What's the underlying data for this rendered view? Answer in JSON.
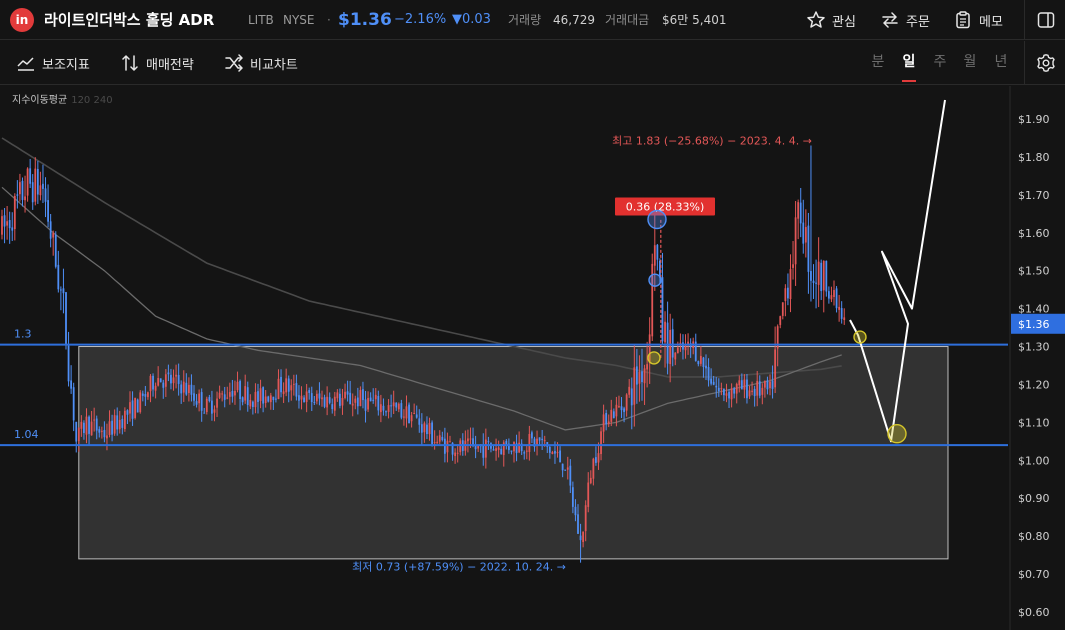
{
  "header": {
    "logo_text": "in",
    "title": "라이트인더박스 홀딩 ADR",
    "ticker": "LITB",
    "exchange": "NYSE",
    "separator": "·",
    "price": "$1.36",
    "change_pct": "−2.16%",
    "change_abs": "▼0.03",
    "volume_label": "거래량",
    "volume_value": "46,729",
    "amount_label": "거래대금",
    "amount_value": "$6만 5,401",
    "buttons": {
      "watch": "관심",
      "order": "주문",
      "memo": "메모"
    }
  },
  "toolbar": {
    "indicators": "보조지표",
    "strategy": "매매전략",
    "compare": "비교차트",
    "periods": [
      "분",
      "일",
      "주",
      "월",
      "년"
    ],
    "active_period": "일",
    "ma_label": "지수이동평균",
    "ma_periods": "120  240"
  },
  "icons": {
    "watch": "star-icon",
    "order": "swap-arrows-icon",
    "memo": "clipboard-icon",
    "panel": "side-panel-icon",
    "settings": "gear-icon",
    "indicators": "line-chart-icon",
    "strategy": "updown-arrows-icon",
    "compare": "shuffle-icon"
  },
  "colors": {
    "accent_blue": "#4f8ff7",
    "up": "#e35757",
    "down": "#4f8ff7",
    "brand_red": "#e23b3b",
    "level_line": "#2e6fdc",
    "highlight": "#d4c52a"
  },
  "chart_data": {
    "type": "candlestick",
    "yaxis_ticks": [
      "$1.90",
      "$1.80",
      "$1.70",
      "$1.60",
      "$1.50",
      "$1.40",
      "$1.30",
      "$1.20",
      "$1.10",
      "$1.00",
      "$0.90",
      "$0.80",
      "$0.70",
      "$0.60"
    ],
    "y_tick_values": [
      1.9,
      1.8,
      1.7,
      1.6,
      1.5,
      1.4,
      1.3,
      1.2,
      1.1,
      1.0,
      0.9,
      0.8,
      0.7,
      0.6
    ],
    "ylim": [
      0.6,
      1.9
    ],
    "current_price_tag": "$1.36",
    "current_price": 1.36,
    "levels": [
      {
        "label": "1.3",
        "value": 1.305
      },
      {
        "label": "1.04",
        "value": 1.04
      }
    ],
    "annotations": {
      "high": "최고 1.83 (−25.68%) − 2023. 4. 4. →",
      "low": "최저 0.73 (+87.59%) − 2022. 10. 24. →",
      "measure": "0.36 (28.33%)"
    },
    "high_value": 1.83,
    "low_value": 0.73,
    "measure_from": 1.27,
    "measure_to": 1.635,
    "range_box": {
      "top": 1.3,
      "bottom": 0.74,
      "start_index": 30,
      "end_index": 350
    },
    "projection_path": [
      1.37,
      1.33,
      1.05,
      1.36,
      1.55,
      1.4,
      1.95
    ],
    "marked_points": [
      {
        "index": 252,
        "value": 1.27,
        "color": "#d4c52a"
      },
      {
        "index": 254,
        "value": 1.475,
        "color": "#4f8ff7"
      },
      {
        "index": 255,
        "value": 1.635,
        "color": "#4f8ff7"
      },
      {
        "index": 333,
        "value": 1.325,
        "color": "#d4c52a"
      },
      {
        "index": 346,
        "value": 1.07,
        "color": "#d4c52a"
      }
    ],
    "candle_count": 330,
    "anchors": [
      [
        0,
        1.6
      ],
      [
        10,
        1.73
      ],
      [
        16,
        1.72
      ],
      [
        24,
        1.4
      ],
      [
        29,
        1.05
      ],
      [
        33,
        1.1
      ],
      [
        40,
        1.07
      ],
      [
        55,
        1.16
      ],
      [
        60,
        1.22
      ],
      [
        70,
        1.2
      ],
      [
        80,
        1.14
      ],
      [
        90,
        1.19
      ],
      [
        100,
        1.16
      ],
      [
        110,
        1.2
      ],
      [
        120,
        1.16
      ],
      [
        140,
        1.16
      ],
      [
        160,
        1.12
      ],
      [
        170,
        1.05
      ],
      [
        180,
        1.03
      ],
      [
        200,
        1.04
      ],
      [
        210,
        1.05
      ],
      [
        220,
        0.99
      ],
      [
        226,
        0.78
      ],
      [
        230,
        0.97
      ],
      [
        236,
        1.12
      ],
      [
        242,
        1.14
      ],
      [
        248,
        1.22
      ],
      [
        252,
        1.27
      ],
      [
        255,
        1.6
      ],
      [
        258,
        1.34
      ],
      [
        262,
        1.28
      ],
      [
        270,
        1.3
      ],
      [
        280,
        1.18
      ],
      [
        290,
        1.19
      ],
      [
        300,
        1.18
      ],
      [
        306,
        1.45
      ],
      [
        312,
        1.66
      ],
      [
        316,
        1.5
      ],
      [
        322,
        1.47
      ],
      [
        329,
        1.36
      ]
    ],
    "overrides": [
      {
        "index": 226,
        "low": 0.73
      },
      {
        "index": 316,
        "high": 1.83
      },
      {
        "index": 255,
        "high": 1.66
      }
    ],
    "ema_120": [
      [
        0,
        1.72
      ],
      [
        20,
        1.6
      ],
      [
        40,
        1.5
      ],
      [
        60,
        1.38
      ],
      [
        80,
        1.32
      ],
      [
        100,
        1.29
      ],
      [
        120,
        1.27
      ],
      [
        140,
        1.25
      ],
      [
        160,
        1.21
      ],
      [
        180,
        1.17
      ],
      [
        200,
        1.13
      ],
      [
        220,
        1.08
      ],
      [
        240,
        1.1
      ],
      [
        260,
        1.15
      ],
      [
        280,
        1.18
      ],
      [
        300,
        1.21
      ],
      [
        320,
        1.26
      ],
      [
        329,
        1.28
      ]
    ],
    "ema_240": [
      [
        0,
        1.85
      ],
      [
        40,
        1.68
      ],
      [
        80,
        1.52
      ],
      [
        120,
        1.42
      ],
      [
        160,
        1.36
      ],
      [
        200,
        1.3
      ],
      [
        220,
        1.27
      ],
      [
        240,
        1.25
      ],
      [
        260,
        1.22
      ],
      [
        280,
        1.22
      ],
      [
        300,
        1.23
      ],
      [
        320,
        1.24
      ],
      [
        329,
        1.25
      ]
    ]
  }
}
